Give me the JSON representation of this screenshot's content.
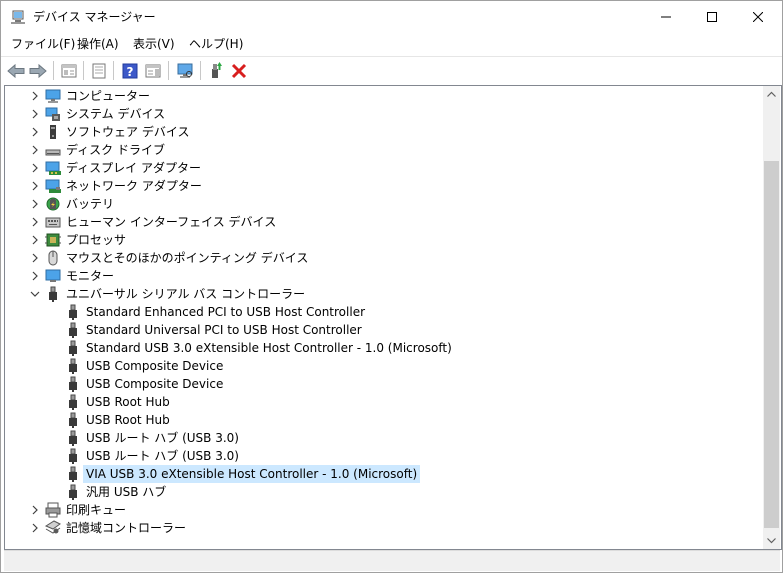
{
  "window": {
    "title": "デバイス マネージャー",
    "controls": [
      "minimize-icon",
      "maximize-icon",
      "close-icon"
    ]
  },
  "menu": [
    "ファイル(F)",
    "操作(A)",
    "表示(V)",
    "ヘルプ(H)"
  ],
  "toolbar": [
    "back-arrow-icon",
    "forward-arrow-icon",
    "show-hide-tree-icon",
    "properties-icon",
    "help-icon",
    "action-pane-icon",
    "scan-hardware-icon",
    "update-driver-icon",
    "uninstall-device-icon"
  ],
  "tree": {
    "nodes": [
      {
        "label": "コンピューター",
        "icon": "computer-icon",
        "expanded": false
      },
      {
        "label": "システム デバイス",
        "icon": "system-devices-icon",
        "expanded": false
      },
      {
        "label": "ソフトウェア デバイス",
        "icon": "software-device-icon",
        "expanded": false
      },
      {
        "label": "ディスク ドライブ",
        "icon": "disk-drive-icon",
        "expanded": false
      },
      {
        "label": "ディスプレイ アダプター",
        "icon": "display-adapter-icon",
        "expanded": false
      },
      {
        "label": "ネットワーク アダプター",
        "icon": "network-adapter-icon",
        "expanded": false
      },
      {
        "label": "バッテリ",
        "icon": "battery-icon",
        "expanded": false
      },
      {
        "label": "ヒューマン インターフェイス デバイス",
        "icon": "hid-icon",
        "expanded": false
      },
      {
        "label": "プロセッサ",
        "icon": "processor-icon",
        "expanded": false
      },
      {
        "label": "マウスとそのほかのポインティング デバイス",
        "icon": "mouse-icon",
        "expanded": false
      },
      {
        "label": "モニター",
        "icon": "monitor-icon",
        "expanded": false
      },
      {
        "label": "ユニバーサル シリアル バス コントローラー",
        "icon": "usb-icon",
        "expanded": true,
        "children": [
          {
            "label": "Standard Enhanced PCI to USB Host Controller",
            "icon": "usb-icon"
          },
          {
            "label": "Standard Universal PCI to USB Host Controller",
            "icon": "usb-icon"
          },
          {
            "label": "Standard USB 3.0 eXtensible Host Controller - 1.0 (Microsoft)",
            "icon": "usb-icon"
          },
          {
            "label": "USB Composite Device",
            "icon": "usb-icon"
          },
          {
            "label": "USB Composite Device",
            "icon": "usb-icon"
          },
          {
            "label": "USB Root Hub",
            "icon": "usb-icon"
          },
          {
            "label": "USB Root Hub",
            "icon": "usb-icon"
          },
          {
            "label": "USB ルート ハブ (USB 3.0)",
            "icon": "usb-icon"
          },
          {
            "label": "USB ルート ハブ (USB 3.0)",
            "icon": "usb-icon"
          },
          {
            "label": "VIA USB 3.0 eXtensible Host Controller - 1.0 (Microsoft)",
            "icon": "usb-icon",
            "selected": true
          },
          {
            "label": "汎用 USB ハブ",
            "icon": "usb-icon"
          }
        ]
      },
      {
        "label": "印刷キュー",
        "icon": "print-queue-icon",
        "expanded": false
      },
      {
        "label": "記憶域コントローラー",
        "icon": "storage-controller-icon",
        "expanded": false
      }
    ]
  },
  "colors": {
    "selection": "#cce8ff",
    "uninstall": "#d81e1e"
  }
}
